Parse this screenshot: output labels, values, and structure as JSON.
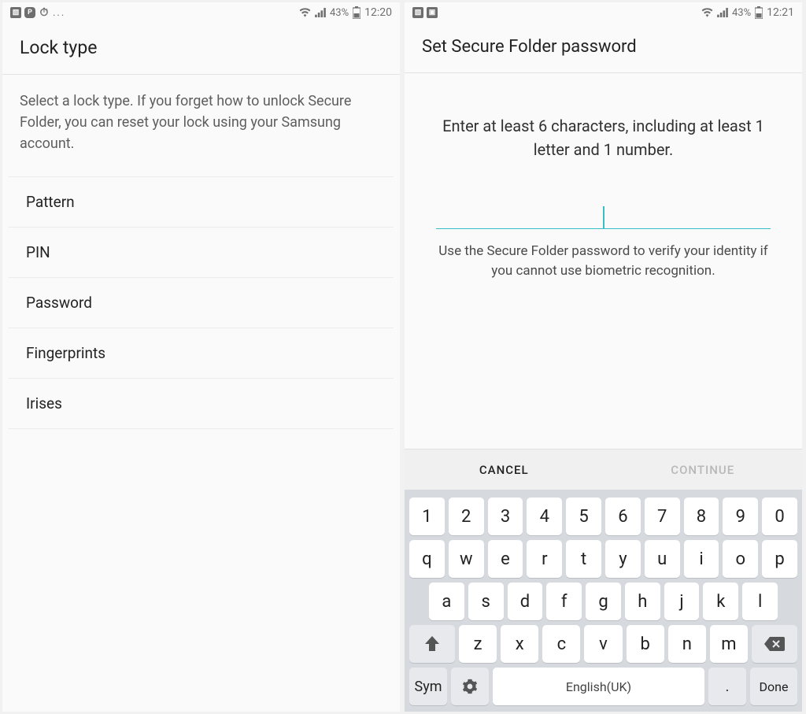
{
  "left": {
    "status": {
      "battery": "43%",
      "time": "12:20"
    },
    "title": "Lock type",
    "description": "Select a lock type. If you forget how to unlock Secure Folder, you can reset your lock using your Samsung account.",
    "items": [
      "Pattern",
      "PIN",
      "Password",
      "Fingerprints",
      "Irises"
    ]
  },
  "right": {
    "status": {
      "battery": "43%",
      "time": "12:21"
    },
    "title": "Set Secure Folder password",
    "instruction": "Enter at least 6 characters, including at least 1 letter and 1 number.",
    "hint": "Use the Secure Folder password to verify your identity if you cannot use biometric recognition.",
    "buttons": {
      "cancel": "CANCEL",
      "continue": "CONTINUE"
    },
    "keyboard": {
      "row1": [
        "1",
        "2",
        "3",
        "4",
        "5",
        "6",
        "7",
        "8",
        "9",
        "0"
      ],
      "row2": [
        "q",
        "w",
        "e",
        "r",
        "t",
        "y",
        "u",
        "i",
        "o",
        "p"
      ],
      "row3": [
        "a",
        "s",
        "d",
        "f",
        "g",
        "h",
        "j",
        "k",
        "l"
      ],
      "row4": [
        "z",
        "x",
        "c",
        "v",
        "b",
        "n",
        "m"
      ],
      "sym": "Sym",
      "space": "English(UK)",
      "period": ".",
      "done": "Done"
    }
  }
}
